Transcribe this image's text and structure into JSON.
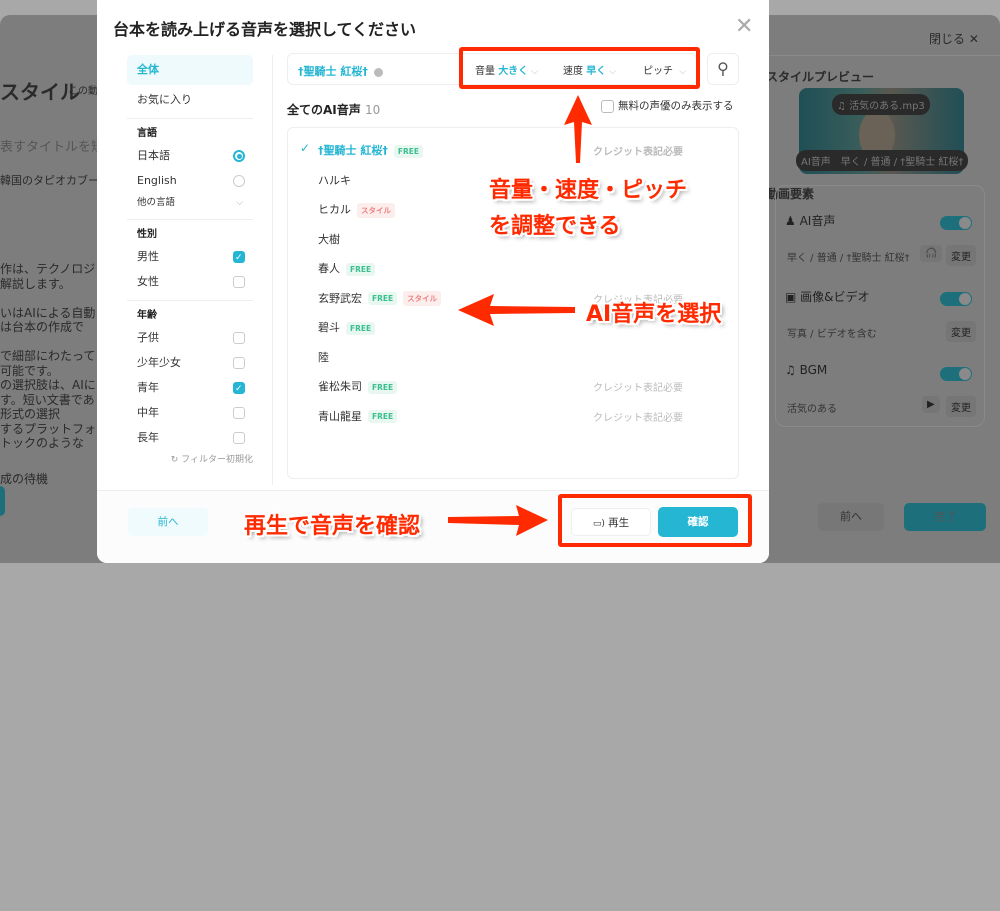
{
  "background": {
    "left": {
      "heading": "スタイル",
      "heading_note": "この動",
      "title_placeholder": "表すタイトルを短",
      "title_value": "韓国のタピオカブー",
      "body_lines": [
        "作は、テクノロジ",
        "解説します。",
        "",
        "いはAIによる自動",
        "は台本の作成で",
        "",
        "で細部にわたって",
        "可能です。",
        "の選択肢は、AIに",
        "す。短い文書であ",
        "形式の選択",
        "するプラットフォ",
        "トックのような"
      ],
      "status": "成の待機"
    },
    "right": {
      "close_label": "閉じる",
      "preview_title": "スタイルプレビュー",
      "preview_music": "活気のある.mp3",
      "preview_voice": "AI音声　早く / 普通 / †聖騎士 紅桜†",
      "elements_title": "動画要素",
      "elements": [
        {
          "label": "AI音声",
          "desc": "早く / 普通 / †聖騎士 紅桜†",
          "action": "変更",
          "icon": "voice-icon",
          "enabled": true
        },
        {
          "label": "画像&ビデオ",
          "desc": "写真 / ビデオを含む",
          "action": "変更",
          "icon": "image-icon",
          "enabled": true
        },
        {
          "label": "BGM",
          "desc": "活気のある",
          "action": "変更",
          "icon": "music-icon",
          "enabled": true
        }
      ],
      "prev_label": "前へ",
      "done_label": "完了"
    }
  },
  "modal": {
    "title": "台本を読み上げる音声を選択してください",
    "sidebar": {
      "all": "全体",
      "favorites": "お気に入り",
      "language_heading": "言語",
      "languages": [
        {
          "label": "日本語",
          "selected": true
        },
        {
          "label": "English",
          "selected": false
        }
      ],
      "other_languages": "他の言語",
      "gender_heading": "性別",
      "genders": [
        {
          "label": "男性",
          "checked": true
        },
        {
          "label": "女性",
          "checked": false
        }
      ],
      "age_heading": "年齢",
      "ages": [
        {
          "label": "子供",
          "checked": false
        },
        {
          "label": "少年少女",
          "checked": false
        },
        {
          "label": "青年",
          "checked": true
        },
        {
          "label": "中年",
          "checked": false
        },
        {
          "label": "長年",
          "checked": false
        }
      ],
      "reset": "フィルター初期化"
    },
    "selected_voice": "†聖騎士 紅桜†",
    "controls": [
      {
        "label": "音量",
        "value": "大きく"
      },
      {
        "label": "速度",
        "value": "早く"
      },
      {
        "label": "ピッチ",
        "value": ""
      }
    ],
    "list_heading": "全てのAI音声",
    "list_count": "10",
    "free_only_label": "無料の声優のみ表示する",
    "free_only_checked": false,
    "voices": [
      {
        "name": "†聖騎士 紅桜†",
        "badges": [
          "FREE"
        ],
        "credit": "クレジット表記必要",
        "selected": true
      },
      {
        "name": "ハルキ",
        "badges": [],
        "credit": ""
      },
      {
        "name": "ヒカル",
        "badges": [
          "スタイル"
        ],
        "credit": ""
      },
      {
        "name": "大樹",
        "badges": [],
        "credit": ""
      },
      {
        "name": "春人",
        "badges": [
          "FREE"
        ],
        "credit": ""
      },
      {
        "name": "玄野武宏",
        "badges": [
          "FREE",
          "スタイル"
        ],
        "credit": "クレジット表記必要"
      },
      {
        "name": "碧斗",
        "badges": [
          "FREE"
        ],
        "credit": ""
      },
      {
        "name": "陸",
        "badges": [],
        "credit": ""
      },
      {
        "name": "雀松朱司",
        "badges": [
          "FREE"
        ],
        "credit": "クレジット表記必要"
      },
      {
        "name": "青山龍星",
        "badges": [
          "FREE"
        ],
        "credit": "クレジット表記必要"
      }
    ],
    "footer": {
      "prev": "前へ",
      "play": "再生",
      "confirm": "確認"
    }
  },
  "annotations": {
    "controls_line1": "音量・速度・ピッチ",
    "controls_line2": "を調整できる",
    "select_voice": "AI音声を選択",
    "play_confirm": "再生で音声を確認"
  },
  "colors": {
    "accent": "#24b6d3",
    "annotation": "#ff2a00",
    "free_badge": "#3bbf8f",
    "style_badge": "#f08080"
  }
}
